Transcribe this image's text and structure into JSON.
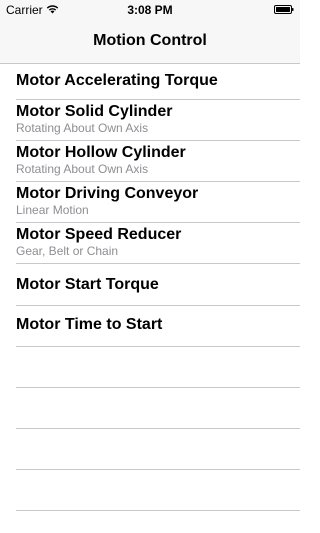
{
  "status_bar": {
    "carrier": "Carrier",
    "time": "3:08 PM"
  },
  "nav": {
    "title": "Motion Control"
  },
  "items": [
    {
      "title": "Motor Accelerating Torque",
      "subtitle": ""
    },
    {
      "title": "Motor Solid Cylinder",
      "subtitle": "Rotating About Own Axis"
    },
    {
      "title": "Motor Hollow Cylinder",
      "subtitle": "Rotating About Own Axis"
    },
    {
      "title": "Motor Driving Conveyor",
      "subtitle": "Linear Motion"
    },
    {
      "title": "Motor Speed Reducer",
      "subtitle": "Gear, Belt or Chain"
    },
    {
      "title": "Motor Start Torque",
      "subtitle": ""
    },
    {
      "title": "Motor Time to Start",
      "subtitle": ""
    }
  ],
  "colors": {
    "nav_background": "#f7f7f7",
    "separator": "#c8c7cc",
    "subtitle_text": "#8e8e93"
  }
}
